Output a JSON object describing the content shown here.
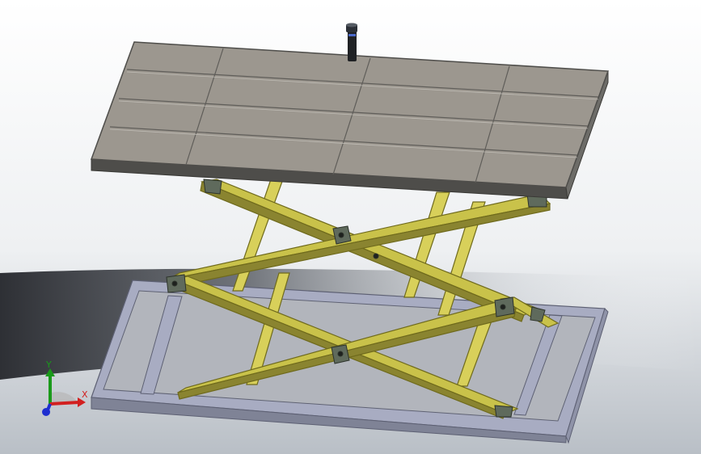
{
  "viewport": {
    "background_top": "#ffffff",
    "background_bottom": "#b9bfc6",
    "background_band": "#3a3d42"
  },
  "model": {
    "platform_color": "#9c978f",
    "platform_edge": "#6b6a67",
    "scissor_color": "#c9c24a",
    "scissor_dark": "#6f6a1c",
    "base_color": "#a8acc2",
    "base_dark": "#5d6073",
    "pin_color": "#5f6a5c",
    "cylinder_color": "#1f2124"
  },
  "triad": {
    "x_label": "X",
    "y_label": "Y",
    "x_color": "#d22020",
    "y_color": "#1a9a1a",
    "z_color": "#1f2fd0",
    "icon": "coordinate-triad-icon"
  }
}
